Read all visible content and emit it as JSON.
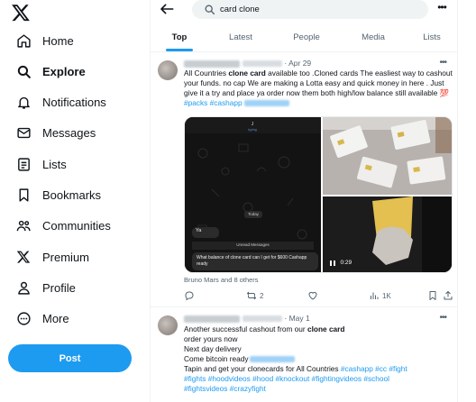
{
  "sidebar": {
    "logo_icon": "x-logo-icon",
    "items": [
      {
        "label": "Home",
        "icon": "home-icon",
        "active": false
      },
      {
        "label": "Explore",
        "icon": "search-icon",
        "active": true
      },
      {
        "label": "Notifications",
        "icon": "bell-icon",
        "active": false
      },
      {
        "label": "Messages",
        "icon": "envelope-icon",
        "active": false
      },
      {
        "label": "Lists",
        "icon": "list-icon",
        "active": false
      },
      {
        "label": "Bookmarks",
        "icon": "bookmark-icon",
        "active": false
      },
      {
        "label": "Communities",
        "icon": "people-icon",
        "active": false
      },
      {
        "label": "Premium",
        "icon": "x-logo-icon",
        "active": false
      },
      {
        "label": "Profile",
        "icon": "person-icon",
        "active": false
      },
      {
        "label": "More",
        "icon": "more-circle-icon",
        "active": false
      }
    ],
    "post_label": "Post"
  },
  "search": {
    "value": "card clone"
  },
  "tabs": [
    {
      "label": "Top",
      "active": true
    },
    {
      "label": "Latest",
      "active": false
    },
    {
      "label": "People",
      "active": false
    },
    {
      "label": "Media",
      "active": false
    },
    {
      "label": "Lists",
      "active": false
    }
  ],
  "tweets": [
    {
      "date": "Apr 29",
      "text_segments": [
        {
          "t": "All Countries "
        },
        {
          "t": "clone card",
          "bold": true
        },
        {
          "t": " available  too .Cloned cards The easliest way to cashout your funds. no cap We are making a Lotta easy and quick money in here . Just give it a try and place ya order now them both high/low balance still available 💯 "
        },
        {
          "t": "#packs",
          "tag": true
        },
        {
          "t": " "
        },
        {
          "t": "#cashapp",
          "tag": true
        }
      ],
      "media": {
        "chat_time_label": "Today",
        "chat_bubble": "Ya",
        "unread_label": "Unread Messages",
        "chat_message": "What balance of clone card can I get for $600 Cashapp ready",
        "video_time": "0:29"
      },
      "liked_by": "Bruno Mars and 8 others",
      "reposts": "2",
      "views": "1K"
    },
    {
      "date": "May 1",
      "lines": [
        [
          {
            "t": "Another successful cashout from our "
          },
          {
            "t": "clone card",
            "bold": true
          }
        ],
        [
          {
            "t": "order yours now"
          }
        ],
        [
          {
            "t": "Next day delivery"
          }
        ],
        [
          {
            "t": "Come bitcoin ready"
          }
        ],
        [
          {
            "t": "Tapin and get your clonecards for All Countries "
          },
          {
            "t": "#cashapp",
            "tag": true
          },
          {
            "t": " "
          },
          {
            "t": "#cc",
            "tag": true
          },
          {
            "t": " "
          },
          {
            "t": "#fight",
            "tag": true
          }
        ],
        [
          {
            "t": "#fights",
            "tag": true
          },
          {
            "t": " "
          },
          {
            "t": "#hoodvideos",
            "tag": true
          },
          {
            "t": " "
          },
          {
            "t": "#hood",
            "tag": true
          },
          {
            "t": " "
          },
          {
            "t": "#knockout",
            "tag": true
          },
          {
            "t": " "
          },
          {
            "t": "#fightingvideos",
            "tag": true
          },
          {
            "t": " "
          },
          {
            "t": "#school",
            "tag": true
          }
        ],
        [
          {
            "t": "#fightsvideos",
            "tag": true
          },
          {
            "t": " "
          },
          {
            "t": "#crazyfight",
            "tag": true
          }
        ]
      ]
    }
  ],
  "colors": {
    "accent": "#1d9bf0",
    "text": "#0f1419",
    "muted": "#536471"
  }
}
